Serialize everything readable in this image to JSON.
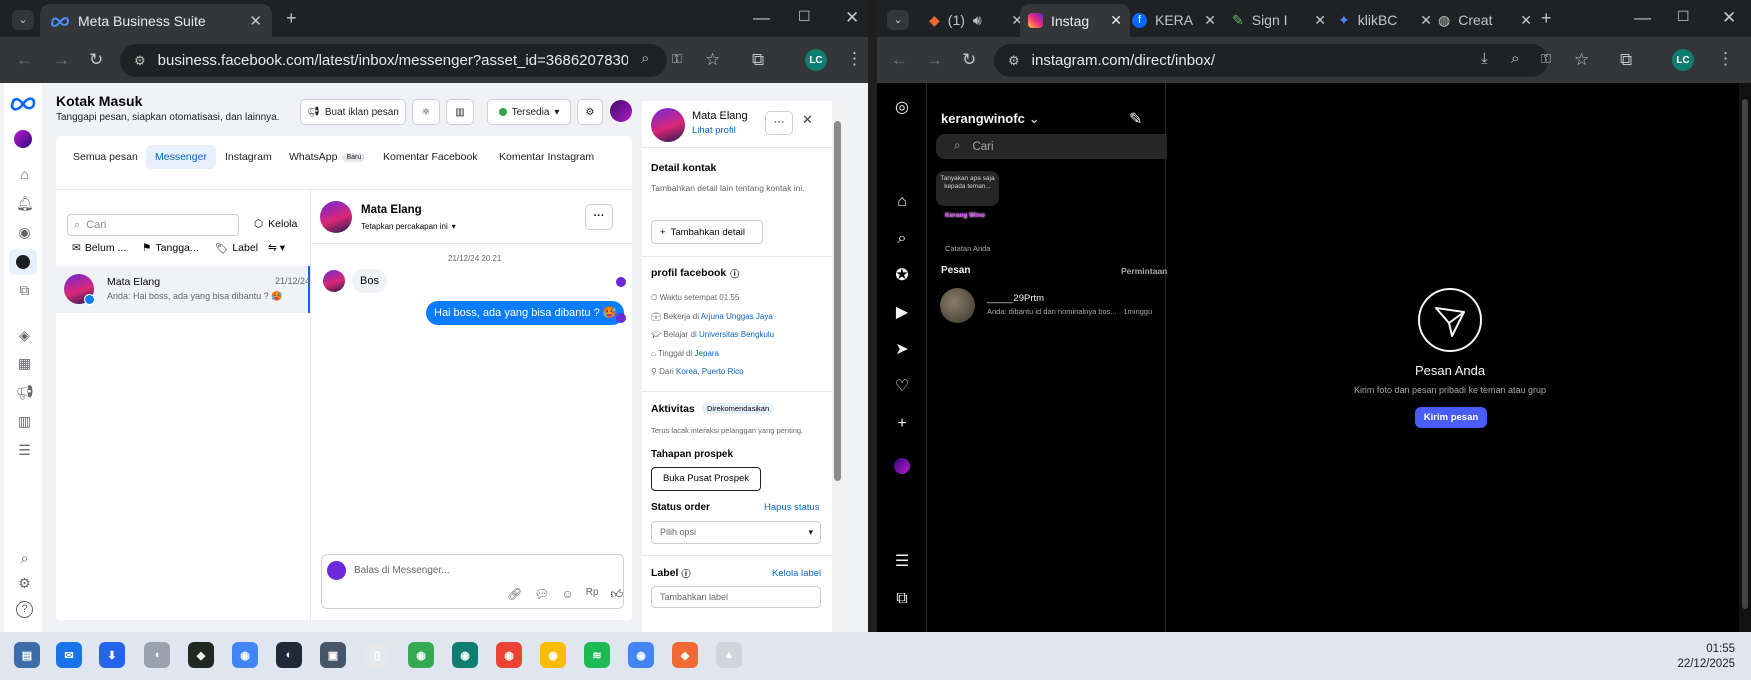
{
  "left_window": {
    "tab_title": "Meta Business Suite",
    "url": "business.facebook.com/latest/inbox/messenger?asset_id=3686207830030...",
    "profile_initials": "LC",
    "header": {
      "title": "Kotak Masuk",
      "subtitle": "Tanggapi pesan, siapkan otomatisasi, dan lainnya."
    },
    "toolbar": {
      "create_ad": "Buat iklan pesan",
      "status": "Tersedia"
    },
    "tabs": [
      "Semua pesan",
      "Messenger",
      "Instagram",
      "WhatsApp",
      "Komentar Facebook",
      "Komentar Instagram"
    ],
    "whatsapp_badge": "Baru",
    "active_tab": "Messenger",
    "search": {
      "placeholder": "Cari",
      "manage": "Kelola"
    },
    "filters": {
      "unread": "Belum ...",
      "date": "Tangga...",
      "label": "Label"
    },
    "conversation": {
      "name": "Mata Elang",
      "date": "21/12/24",
      "preview": "Anda: Hai boss, ada yang bisa dibantu ? 🥵"
    },
    "chat": {
      "name": "Mata Elang",
      "assign": "Tetapkan percakapan ini",
      "timestamp": "21/12/24 20.21",
      "incoming": "Bos",
      "outgoing": "Hai boss, ada yang bisa dibantu ? 🥵",
      "reply_placeholder": "Balas di Messenger...",
      "currency_icon": "Rp"
    },
    "contact": {
      "name": "Mata Elang",
      "view_profile": "Lihat profil",
      "details_title": "Detail kontak",
      "details_desc": "Tambahkan detail lain tentang kontak ini.",
      "add_detail": "Tambahkan detail",
      "fb_profile_title": "profil facebook",
      "local_time": "Waktu setempat 01.55",
      "work_prefix": "Bekerja di",
      "work": "Arjuna Unggas Jaya",
      "study_prefix": "Belajar di",
      "study": "Universitas Bengkulu",
      "live_prefix": "Tinggal di",
      "live": "Jepara",
      "from_prefix": "Dari",
      "from": "Korea, Puerto Rico",
      "activity_title": "Aktivitas",
      "activity_badge": "Direkomendasikan",
      "activity_desc": "Terus lacak interaksi pelanggan yang penting.",
      "prospect_title": "Tahapan prospek",
      "prospect_btn": "Buka Pusat Prospek",
      "order_title": "Status order",
      "order_clear": "Hapus status",
      "order_select": "Pilih opsi",
      "label_title": "Label",
      "label_manage": "Kelola label",
      "label_input": "Tambahkan label"
    }
  },
  "right_window": {
    "tabs": [
      {
        "label": "(1)",
        "active": false
      },
      {
        "label": "Instag",
        "active": true
      },
      {
        "label": "KERA",
        "active": false
      },
      {
        "label": "Sign I",
        "active": false
      },
      {
        "label": "klikBC",
        "active": false
      },
      {
        "label": "Creat",
        "active": false
      }
    ],
    "url": "instagram.com/direct/inbox/",
    "profile_initials": "LC",
    "username": "kerangwinofc",
    "search_placeholder": "Cari",
    "note_bubble": "Tanyakan apa saja kepada teman...",
    "note_logo_text": "Kerang Wino",
    "note_label": "Catatan Anda",
    "messages_label": "Pesan",
    "requests_label": "Permintaan",
    "thread": {
      "name": "_____29Prtm",
      "preview": "Anda: dibantu id dan nominalnya bos...",
      "time": "· 1minggu"
    },
    "empty": {
      "title": "Pesan Anda",
      "desc": "Kirim foto dan pesan pribadi ke teman atau grup",
      "button": "Kirim pesan"
    }
  },
  "taskbar": {
    "time": "01:55",
    "date": "22/12/2025"
  },
  "colors": {
    "fb_blue": "#0866ff",
    "ig_button": "#4a5df9",
    "messenger_bubble": "#0a7cff"
  }
}
